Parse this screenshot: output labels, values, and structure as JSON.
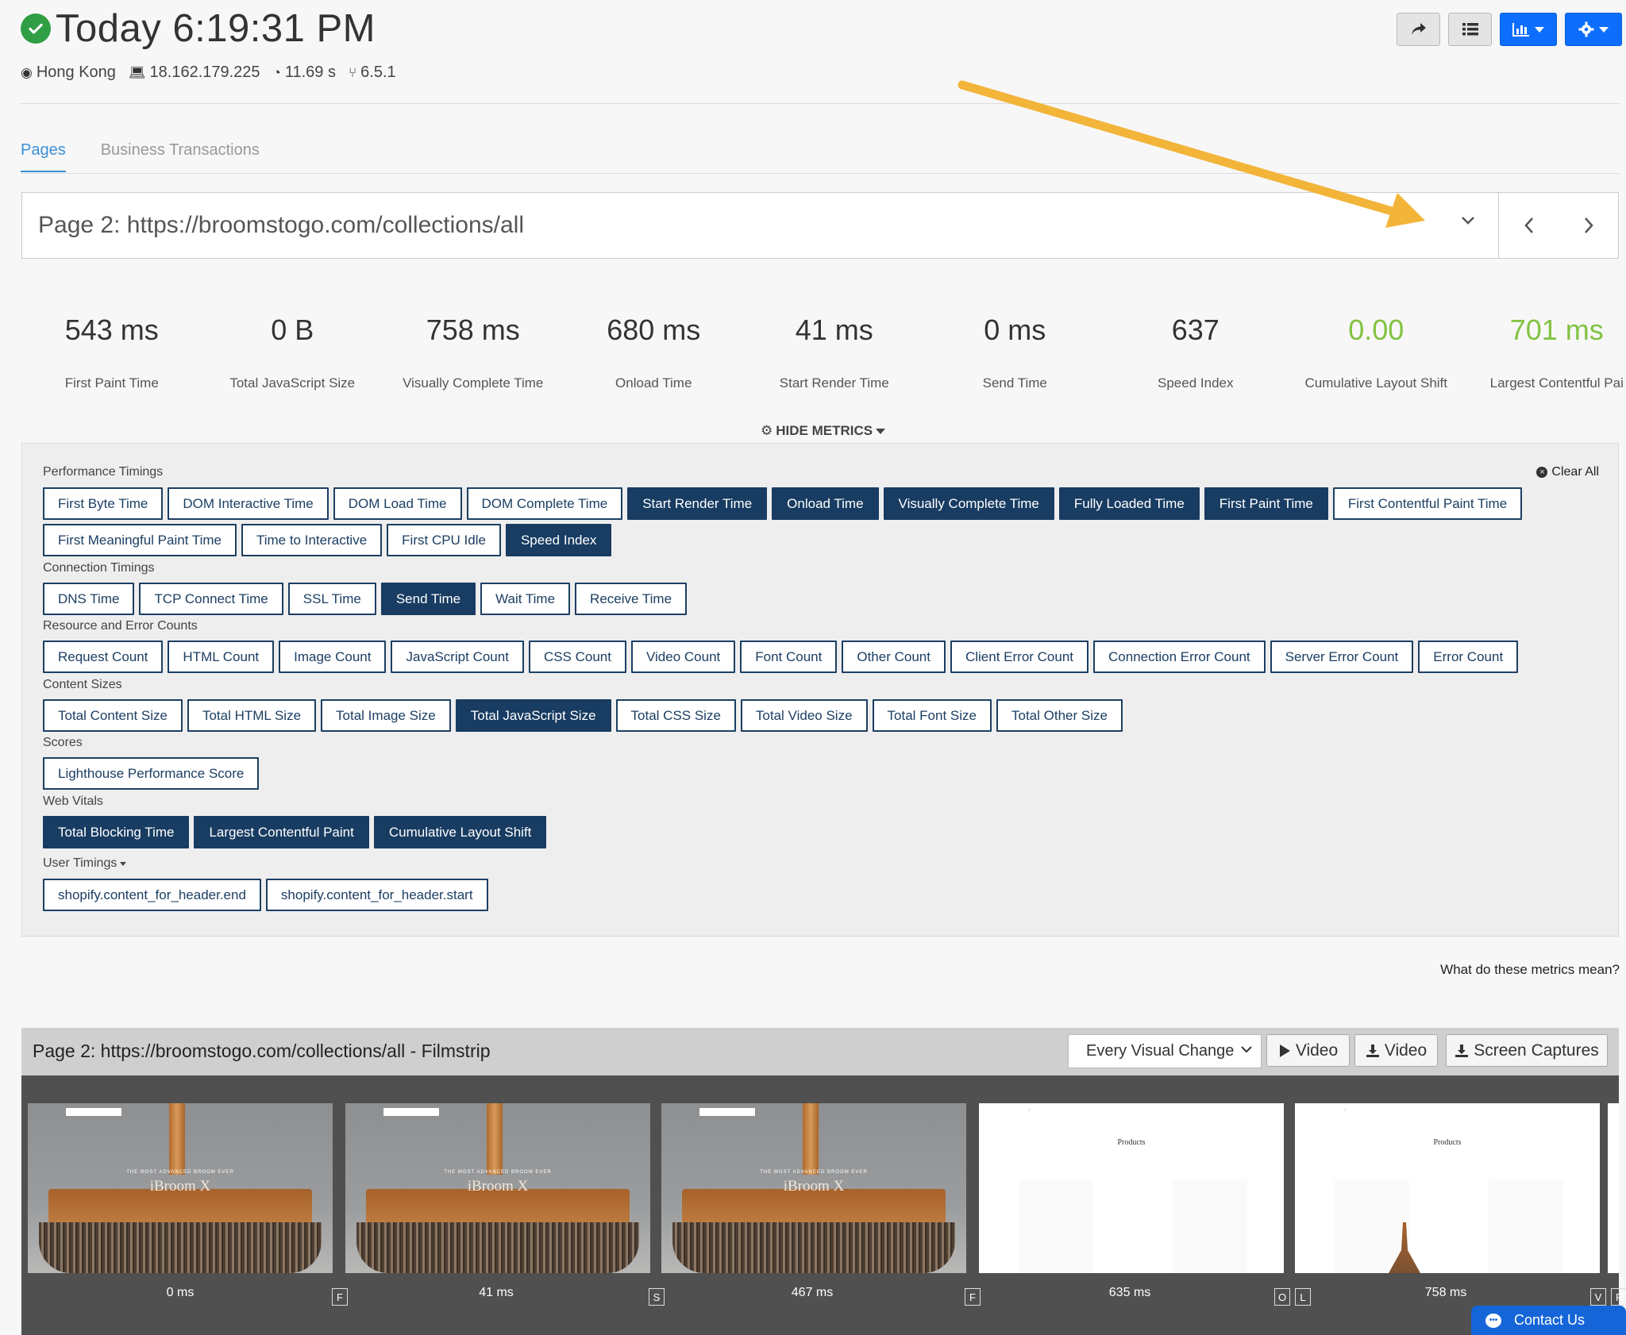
{
  "header": {
    "title": "Today 6:19:31 PM",
    "meta": {
      "location": "Hong Kong",
      "ip": "18.162.179.225",
      "duration": "11.69 s",
      "version": "6.5.1"
    }
  },
  "tabs": [
    {
      "label": "Pages",
      "active": true
    },
    {
      "label": "Business Transactions",
      "active": false
    }
  ],
  "page_selector": {
    "value": "Page 2: https://broomstogo.com/collections/all"
  },
  "metrics": [
    {
      "value": "543 ms",
      "label": "First Paint Time"
    },
    {
      "value": "0 B",
      "label": "Total JavaScript Size"
    },
    {
      "value": "758 ms",
      "label": "Visually Complete Time"
    },
    {
      "value": "680 ms",
      "label": "Onload Time"
    },
    {
      "value": "41 ms",
      "label": "Start Render Time"
    },
    {
      "value": "0 ms",
      "label": "Send Time"
    },
    {
      "value": "637",
      "label": "Speed Index"
    },
    {
      "value": "0.00",
      "label": "Cumulative Layout Shift",
      "color": "#82c341"
    },
    {
      "value": "701 ms",
      "label": "Largest Contentful Pai",
      "color": "#82c341"
    }
  ],
  "hide_metrics_label": "HIDE METRICS",
  "clear_all_label": "Clear All",
  "groups": {
    "performance": {
      "label": "Performance Timings",
      "row1": [
        {
          "label": "First Byte Time",
          "on": false
        },
        {
          "label": "DOM Interactive Time",
          "on": false
        },
        {
          "label": "DOM Load Time",
          "on": false
        },
        {
          "label": "DOM Complete Time",
          "on": false
        },
        {
          "label": "Start Render Time",
          "on": true
        },
        {
          "label": "Onload Time",
          "on": true
        },
        {
          "label": "Visually Complete Time",
          "on": true
        },
        {
          "label": "Fully Loaded Time",
          "on": true
        },
        {
          "label": "First Paint Time",
          "on": true
        },
        {
          "label": "First Contentful Paint Time",
          "on": false
        }
      ],
      "row2": [
        {
          "label": "First Meaningful Paint Time",
          "on": false
        },
        {
          "label": "Time to Interactive",
          "on": false
        },
        {
          "label": "First CPU Idle",
          "on": false
        },
        {
          "label": "Speed Index",
          "on": true
        }
      ]
    },
    "connection": {
      "label": "Connection Timings",
      "items": [
        {
          "label": "DNS Time",
          "on": false
        },
        {
          "label": "TCP Connect Time",
          "on": false
        },
        {
          "label": "SSL Time",
          "on": false
        },
        {
          "label": "Send Time",
          "on": true
        },
        {
          "label": "Wait Time",
          "on": false
        },
        {
          "label": "Receive Time",
          "on": false
        }
      ]
    },
    "resources": {
      "label": "Resource and Error Counts",
      "items": [
        {
          "label": "Request Count",
          "on": false
        },
        {
          "label": "HTML Count",
          "on": false
        },
        {
          "label": "Image Count",
          "on": false
        },
        {
          "label": "JavaScript Count",
          "on": false
        },
        {
          "label": "CSS Count",
          "on": false
        },
        {
          "label": "Video Count",
          "on": false
        },
        {
          "label": "Font Count",
          "on": false
        },
        {
          "label": "Other Count",
          "on": false
        },
        {
          "label": "Client Error Count",
          "on": false
        },
        {
          "label": "Connection Error Count",
          "on": false
        },
        {
          "label": "Server Error Count",
          "on": false
        },
        {
          "label": "Error Count",
          "on": false
        }
      ]
    },
    "sizes": {
      "label": "Content Sizes",
      "items": [
        {
          "label": "Total Content Size",
          "on": false
        },
        {
          "label": "Total HTML Size",
          "on": false
        },
        {
          "label": "Total Image Size",
          "on": false
        },
        {
          "label": "Total JavaScript Size",
          "on": true
        },
        {
          "label": "Total CSS Size",
          "on": false
        },
        {
          "label": "Total Video Size",
          "on": false
        },
        {
          "label": "Total Font Size",
          "on": false
        },
        {
          "label": "Total Other Size",
          "on": false
        }
      ]
    },
    "scores": {
      "label": "Scores",
      "items": [
        {
          "label": "Lighthouse Performance Score",
          "on": false
        }
      ]
    },
    "vitals": {
      "label": "Web Vitals",
      "items": [
        {
          "label": "Total Blocking Time",
          "on": true
        },
        {
          "label": "Largest Contentful Paint",
          "on": true
        },
        {
          "label": "Cumulative Layout Shift",
          "on": true
        }
      ]
    },
    "user": {
      "label": "User Timings",
      "items": [
        {
          "label": "shopify.content_for_header.end",
          "on": false
        },
        {
          "label": "shopify.content_for_header.start",
          "on": false
        }
      ]
    }
  },
  "what_link": "What do these metrics mean?",
  "filmstrip": {
    "title": "Page 2: https://broomstogo.com/collections/all - Filmstrip",
    "select_value": "Every Visual Change",
    "buttons": {
      "play_video": "Video",
      "download_video": "Video",
      "screen_captures": "Screen Captures"
    },
    "frames": [
      {
        "time": "0 ms",
        "badges": [
          "F"
        ],
        "kind": "broom",
        "brand": "iBroom X",
        "tagline": "THE MOST ADVANCED BROOM EVER"
      },
      {
        "time": "41 ms",
        "badges": [
          "S"
        ],
        "kind": "broom",
        "brand": "iBroom X",
        "tagline": "THE MOST ADVANCED BROOM EVER"
      },
      {
        "time": "467 ms",
        "badges": [
          "F"
        ],
        "kind": "broom",
        "brand": "iBroom X",
        "tagline": "THE MOST ADVANCED BROOM EVER"
      },
      {
        "time": "635 ms",
        "badges": [
          "O",
          "L"
        ],
        "kind": "white",
        "heading": "Products"
      },
      {
        "time": "758 ms",
        "badges": [
          "V",
          "F"
        ],
        "kind": "white2",
        "heading": "Products"
      }
    ]
  },
  "contact_label": "Contact Us",
  "colors": {
    "accent": "#0d6efd",
    "chip_on": "#183c62",
    "green": "#82c341",
    "tab_active": "#3b8fd6"
  }
}
